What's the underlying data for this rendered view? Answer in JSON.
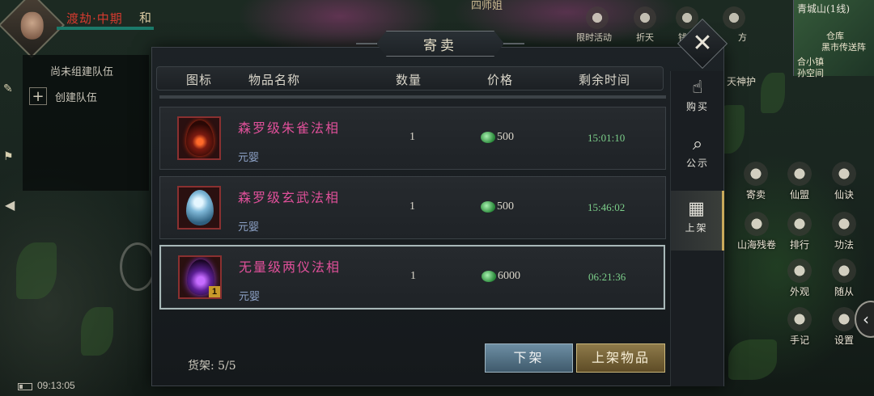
{
  "hero": {
    "name": "渡劫·中期",
    "zone": "和"
  },
  "team": {
    "title": "尚未组建队伍",
    "create_label": "创建队伍"
  },
  "status": {
    "time": "09:13:05"
  },
  "top_banner": "四师姐",
  "top_menu": [
    {
      "icon": "temple-icon",
      "label": "限时活动"
    },
    {
      "icon": "gate-icon",
      "label": "折天"
    },
    {
      "icon": "scroll-icon",
      "label": "钱"
    },
    {
      "icon": "pagoda-icon",
      "label": "方"
    }
  ],
  "minimap": {
    "title": "青城山(1线)",
    "labels": [
      "黑市传送阵",
      "仓库",
      "合小镇",
      "孙空间"
    ]
  },
  "right_menu": [
    {
      "icon": "consign-icon",
      "label": "寄卖"
    },
    {
      "icon": "alliance-icon",
      "label": "仙盟"
    },
    {
      "icon": "immortal-art-icon",
      "label": "仙诀"
    },
    {
      "icon": "atlas-icon",
      "label": "山海残卷"
    },
    {
      "icon": "ranking-icon",
      "label": "排行"
    },
    {
      "icon": "skill-icon",
      "label": "功法"
    },
    {
      "icon": "appearance-icon",
      "label": "外观"
    },
    {
      "icon": "follower-icon",
      "label": "随从"
    },
    {
      "icon": "notes-icon",
      "label": "手记"
    },
    {
      "icon": "settings-icon",
      "label": "设置"
    }
  ],
  "top_right_label": "天神护",
  "modal": {
    "title": "寄卖",
    "columns": [
      "图标",
      "物品名称",
      "数量",
      "价格",
      "剩余时间"
    ],
    "items": [
      {
        "name": "森罗级朱雀法相",
        "category": "元婴",
        "qty": "1",
        "price": "500",
        "time": "15:01:10",
        "egg": "red",
        "badge": ""
      },
      {
        "name": "森罗级玄武法相",
        "category": "元婴",
        "qty": "1",
        "price": "500",
        "time": "15:46:02",
        "egg": "blue",
        "badge": ""
      },
      {
        "name": "无量级两仪法相",
        "category": "元婴",
        "qty": "1",
        "price": "6000",
        "time": "06:21:36",
        "egg": "purple",
        "badge": "1"
      }
    ],
    "shelf": "货架: 5/5",
    "unlist_button": "下架",
    "list_button": "上架物品",
    "tabs": [
      {
        "icon": "buy-hand-icon",
        "label": "购买"
      },
      {
        "icon": "notice-icon",
        "label": "公示"
      },
      {
        "icon": "shelf-icon",
        "label": "上架"
      }
    ]
  }
}
